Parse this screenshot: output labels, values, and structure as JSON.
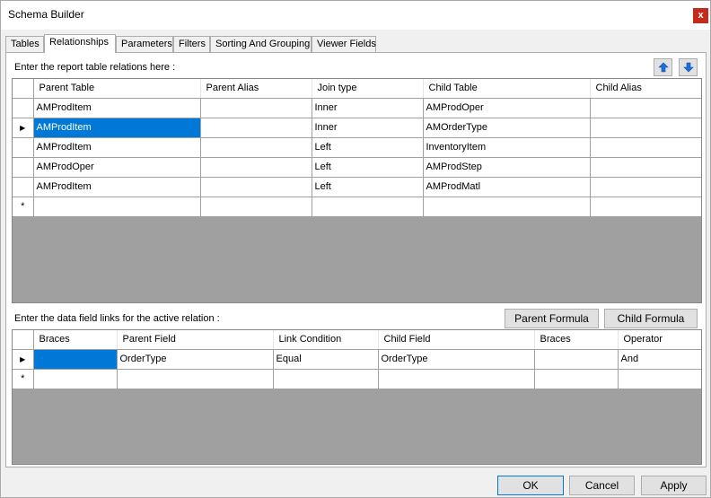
{
  "window": {
    "title": "Schema Builder",
    "close_glyph": "x"
  },
  "tabs": [
    {
      "label": "Tables"
    },
    {
      "label": "Relationships"
    },
    {
      "label": "Parameters"
    },
    {
      "label": "Filters"
    },
    {
      "label": "Sorting And Grouping"
    },
    {
      "label": "Viewer Fields"
    }
  ],
  "relations": {
    "prompt": "Enter the report table relations here :",
    "move_up_icon": "arrow-up",
    "move_down_icon": "arrow-down",
    "columns": [
      "Parent Table",
      "Parent Alias",
      "Join type",
      "Child Table",
      "Child Alias"
    ],
    "rows": [
      {
        "parent_table": "AMProdItem",
        "parent_alias": "",
        "join_type": "Inner",
        "child_table": "AMProdOper",
        "child_alias": ""
      },
      {
        "parent_table": "AMProdItem",
        "parent_alias": "",
        "join_type": "Inner",
        "child_table": "AMOrderType",
        "child_alias": ""
      },
      {
        "parent_table": "AMProdItem",
        "parent_alias": "",
        "join_type": "Left",
        "child_table": "InventoryItem",
        "child_alias": ""
      },
      {
        "parent_table": "AMProdOper",
        "parent_alias": "",
        "join_type": "Left",
        "child_table": "AMProdStep",
        "child_alias": ""
      },
      {
        "parent_table": "AMProdItem",
        "parent_alias": "",
        "join_type": "Left",
        "child_table": "AMProdMatl",
        "child_alias": ""
      }
    ],
    "current_row_marker": "▶",
    "new_row_marker": "*"
  },
  "links": {
    "prompt": "Enter the data field links for the active relation :",
    "parent_formula_label": "Parent Formula",
    "child_formula_label": "Child Formula",
    "columns": [
      "Braces",
      "Parent Field",
      "Link Condition",
      "Child Field",
      "Braces",
      "Operator"
    ],
    "rows": [
      {
        "braces_open": "",
        "parent_field": "OrderType",
        "link_condition": "Equal",
        "child_field": "OrderType",
        "braces_close": "",
        "operator": "And"
      }
    ],
    "current_row_marker": "▶",
    "new_row_marker": "*"
  },
  "footer": {
    "ok_label": "OK",
    "cancel_label": "Cancel",
    "apply_label": "Apply"
  },
  "colors": {
    "selection": "#0078d7",
    "grid_empty": "#a0a0a0",
    "close_button": "#c42b1c"
  }
}
